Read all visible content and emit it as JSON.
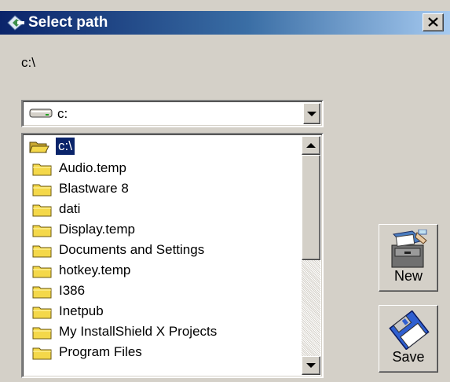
{
  "window": {
    "title": "Select path"
  },
  "current_path": "c:\\",
  "drive_selector": {
    "value": "c:"
  },
  "folders": [
    {
      "label": "c:\\",
      "selected": true,
      "open": true
    },
    {
      "label": "Audio.temp"
    },
    {
      "label": "Blastware 8"
    },
    {
      "label": "dati"
    },
    {
      "label": "Display.temp"
    },
    {
      "label": "Documents and Settings"
    },
    {
      "label": "hotkey.temp"
    },
    {
      "label": "I386"
    },
    {
      "label": "Inetpub"
    },
    {
      "label": "My InstallShield X Projects"
    },
    {
      "label": "Program Files"
    }
  ],
  "buttons": {
    "new_label": "New",
    "save_label": "Save"
  },
  "colors": {
    "title_start": "#0a246a",
    "title_end": "#a6caf0",
    "selection": "#0a246a",
    "face": "#d4d0c8",
    "folder": "#f4d84a"
  }
}
